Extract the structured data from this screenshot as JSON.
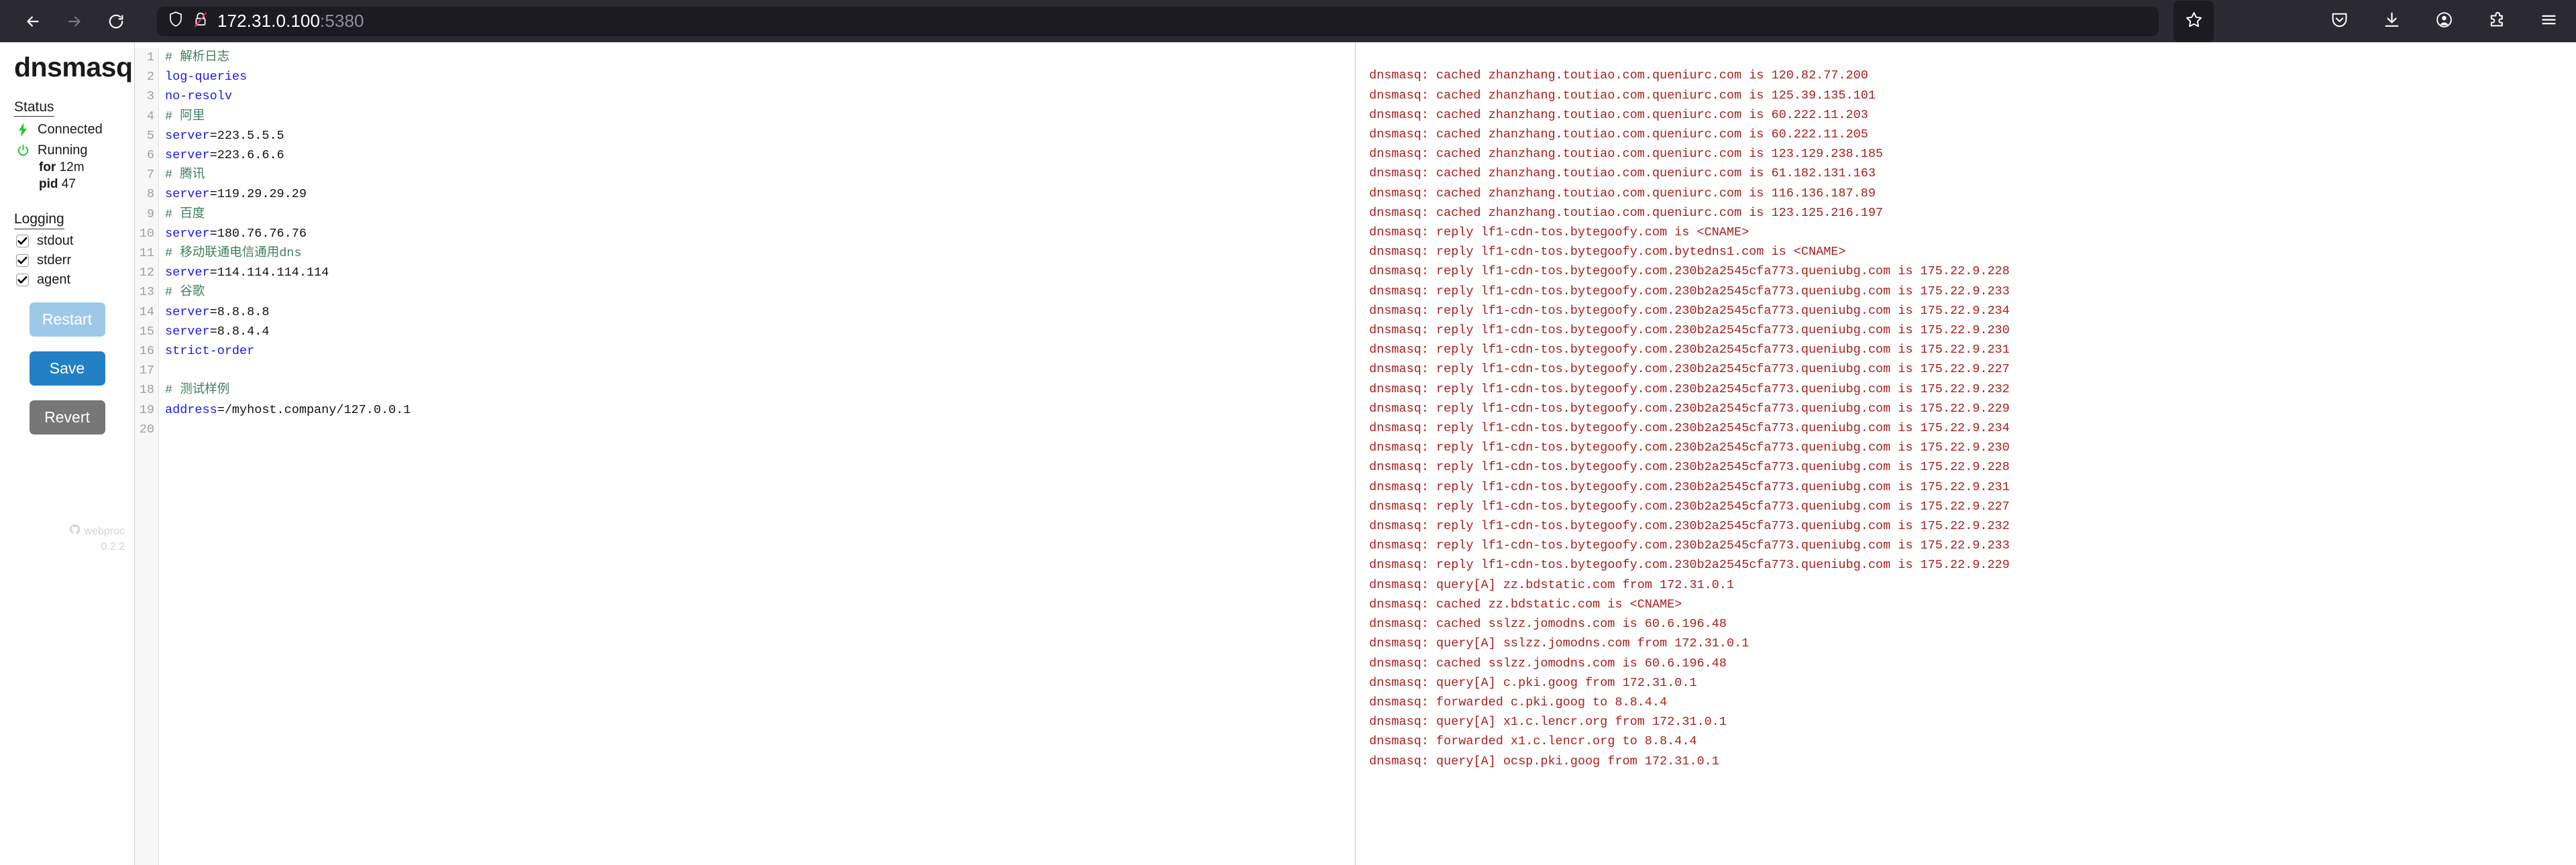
{
  "browser": {
    "back_icon": "arrow-left-icon",
    "forward_icon": "arrow-right-icon",
    "reload_icon": "reload-icon",
    "shield_icon": "shield-icon",
    "insecure_icon": "broken-lock-icon",
    "url_host": "172.31.0.100",
    "url_port": ":5380",
    "bookmark_icon": "star-icon",
    "pocket_icon": "pocket-icon",
    "downloads_icon": "download-icon",
    "account_icon": "account-icon",
    "extensions_icon": "puzzle-icon",
    "menu_icon": "hamburger-menu-icon"
  },
  "sidebar": {
    "title": "dnsmasq",
    "status_heading": "Status",
    "connected_label": "Connected",
    "connected_icon": "lightning-bolt-icon",
    "running_label": "Running",
    "running_icon": "power-icon",
    "uptime_key": "for",
    "uptime_value": "12m",
    "pid_key": "pid",
    "pid_value": "47",
    "logging_heading": "Logging",
    "checkboxes": [
      {
        "label": "stdout",
        "checked": true
      },
      {
        "label": "stderr",
        "checked": true
      },
      {
        "label": "agent",
        "checked": true
      }
    ],
    "restart_label": "Restart",
    "save_label": "Save",
    "revert_label": "Revert",
    "footer_icon": "github-icon",
    "footer_name": "webproc",
    "footer_version": "0.2.2",
    "colors": {
      "restart": "#9dc9e9",
      "save": "#2380c5",
      "revert": "#777777",
      "connected": "#1ecb2f",
      "running": "#1ecb2f"
    }
  },
  "editor": {
    "line_numbers": [
      1,
      2,
      3,
      4,
      5,
      6,
      7,
      8,
      9,
      10,
      11,
      12,
      13,
      14,
      15,
      16,
      17,
      18,
      19,
      20
    ],
    "lines": [
      {
        "n": 1,
        "type": "comment",
        "text": "# 解析日志"
      },
      {
        "n": 2,
        "type": "key",
        "key": "log-queries",
        "value": ""
      },
      {
        "n": 3,
        "type": "key",
        "key": "no-resolv",
        "value": ""
      },
      {
        "n": 4,
        "type": "comment",
        "text": "# 阿里"
      },
      {
        "n": 5,
        "type": "pair",
        "key": "server",
        "value": "=223.5.5.5"
      },
      {
        "n": 6,
        "type": "pair",
        "key": "server",
        "value": "=223.6.6.6"
      },
      {
        "n": 7,
        "type": "comment",
        "text": "# 腾讯"
      },
      {
        "n": 8,
        "type": "pair",
        "key": "server",
        "value": "=119.29.29.29"
      },
      {
        "n": 9,
        "type": "comment",
        "text": "# 百度"
      },
      {
        "n": 10,
        "type": "pair",
        "key": "server",
        "value": "=180.76.76.76"
      },
      {
        "n": 11,
        "type": "comment",
        "text": "# 移动联通电信通用dns"
      },
      {
        "n": 12,
        "type": "pair",
        "key": "server",
        "value": "=114.114.114.114"
      },
      {
        "n": 13,
        "type": "comment",
        "text": "# 谷歌"
      },
      {
        "n": 14,
        "type": "pair",
        "key": "server",
        "value": "=8.8.8.8"
      },
      {
        "n": 15,
        "type": "pair",
        "key": "server",
        "value": "=8.8.4.4"
      },
      {
        "n": 16,
        "type": "key",
        "key": "strict-order",
        "value": ""
      },
      {
        "n": 17,
        "type": "blank",
        "text": ""
      },
      {
        "n": 18,
        "type": "comment",
        "text": "# 测试样例"
      },
      {
        "n": 19,
        "type": "pair",
        "key": "address",
        "value": "=/myhost.company/127.0.0.1"
      },
      {
        "n": 20,
        "type": "blank",
        "text": ""
      }
    ]
  },
  "log": {
    "color": "#a81f1f",
    "lines": [
      "dnsmasq: cached zhanzhang.toutiao.com.queniurc.com is 120.82.77.200",
      "dnsmasq: cached zhanzhang.toutiao.com.queniurc.com is 125.39.135.101",
      "dnsmasq: cached zhanzhang.toutiao.com.queniurc.com is 60.222.11.203",
      "dnsmasq: cached zhanzhang.toutiao.com.queniurc.com is 60.222.11.205",
      "dnsmasq: cached zhanzhang.toutiao.com.queniurc.com is 123.129.238.185",
      "dnsmasq: cached zhanzhang.toutiao.com.queniurc.com is 61.182.131.163",
      "dnsmasq: cached zhanzhang.toutiao.com.queniurc.com is 116.136.187.89",
      "dnsmasq: cached zhanzhang.toutiao.com.queniurc.com is 123.125.216.197",
      "dnsmasq: reply lf1-cdn-tos.bytegoofy.com is <CNAME>",
      "dnsmasq: reply lf1-cdn-tos.bytegoofy.com.bytedns1.com is <CNAME>",
      "dnsmasq: reply lf1-cdn-tos.bytegoofy.com.230b2a2545cfa773.queniubg.com is 175.22.9.228",
      "dnsmasq: reply lf1-cdn-tos.bytegoofy.com.230b2a2545cfa773.queniubg.com is 175.22.9.233",
      "dnsmasq: reply lf1-cdn-tos.bytegoofy.com.230b2a2545cfa773.queniubg.com is 175.22.9.234",
      "dnsmasq: reply lf1-cdn-tos.bytegoofy.com.230b2a2545cfa773.queniubg.com is 175.22.9.230",
      "dnsmasq: reply lf1-cdn-tos.bytegoofy.com.230b2a2545cfa773.queniubg.com is 175.22.9.231",
      "dnsmasq: reply lf1-cdn-tos.bytegoofy.com.230b2a2545cfa773.queniubg.com is 175.22.9.227",
      "dnsmasq: reply lf1-cdn-tos.bytegoofy.com.230b2a2545cfa773.queniubg.com is 175.22.9.232",
      "dnsmasq: reply lf1-cdn-tos.bytegoofy.com.230b2a2545cfa773.queniubg.com is 175.22.9.229",
      "dnsmasq: reply lf1-cdn-tos.bytegoofy.com.230b2a2545cfa773.queniubg.com is 175.22.9.234",
      "dnsmasq: reply lf1-cdn-tos.bytegoofy.com.230b2a2545cfa773.queniubg.com is 175.22.9.230",
      "dnsmasq: reply lf1-cdn-tos.bytegoofy.com.230b2a2545cfa773.queniubg.com is 175.22.9.228",
      "dnsmasq: reply lf1-cdn-tos.bytegoofy.com.230b2a2545cfa773.queniubg.com is 175.22.9.231",
      "dnsmasq: reply lf1-cdn-tos.bytegoofy.com.230b2a2545cfa773.queniubg.com is 175.22.9.227",
      "dnsmasq: reply lf1-cdn-tos.bytegoofy.com.230b2a2545cfa773.queniubg.com is 175.22.9.232",
      "dnsmasq: reply lf1-cdn-tos.bytegoofy.com.230b2a2545cfa773.queniubg.com is 175.22.9.233",
      "dnsmasq: reply lf1-cdn-tos.bytegoofy.com.230b2a2545cfa773.queniubg.com is 175.22.9.229",
      "dnsmasq: query[A] zz.bdstatic.com from 172.31.0.1",
      "dnsmasq: cached zz.bdstatic.com is <CNAME>",
      "dnsmasq: cached sslzz.jomodns.com is 60.6.196.48",
      "dnsmasq: query[A] sslzz.jomodns.com from 172.31.0.1",
      "dnsmasq: cached sslzz.jomodns.com is 60.6.196.48",
      "dnsmasq: query[A] c.pki.goog from 172.31.0.1",
      "dnsmasq: forwarded c.pki.goog to 8.8.4.4",
      "dnsmasq: query[A] x1.c.lencr.org from 172.31.0.1",
      "dnsmasq: forwarded x1.c.lencr.org to 8.8.4.4",
      "dnsmasq: query[A] ocsp.pki.goog from 172.31.0.1"
    ]
  }
}
